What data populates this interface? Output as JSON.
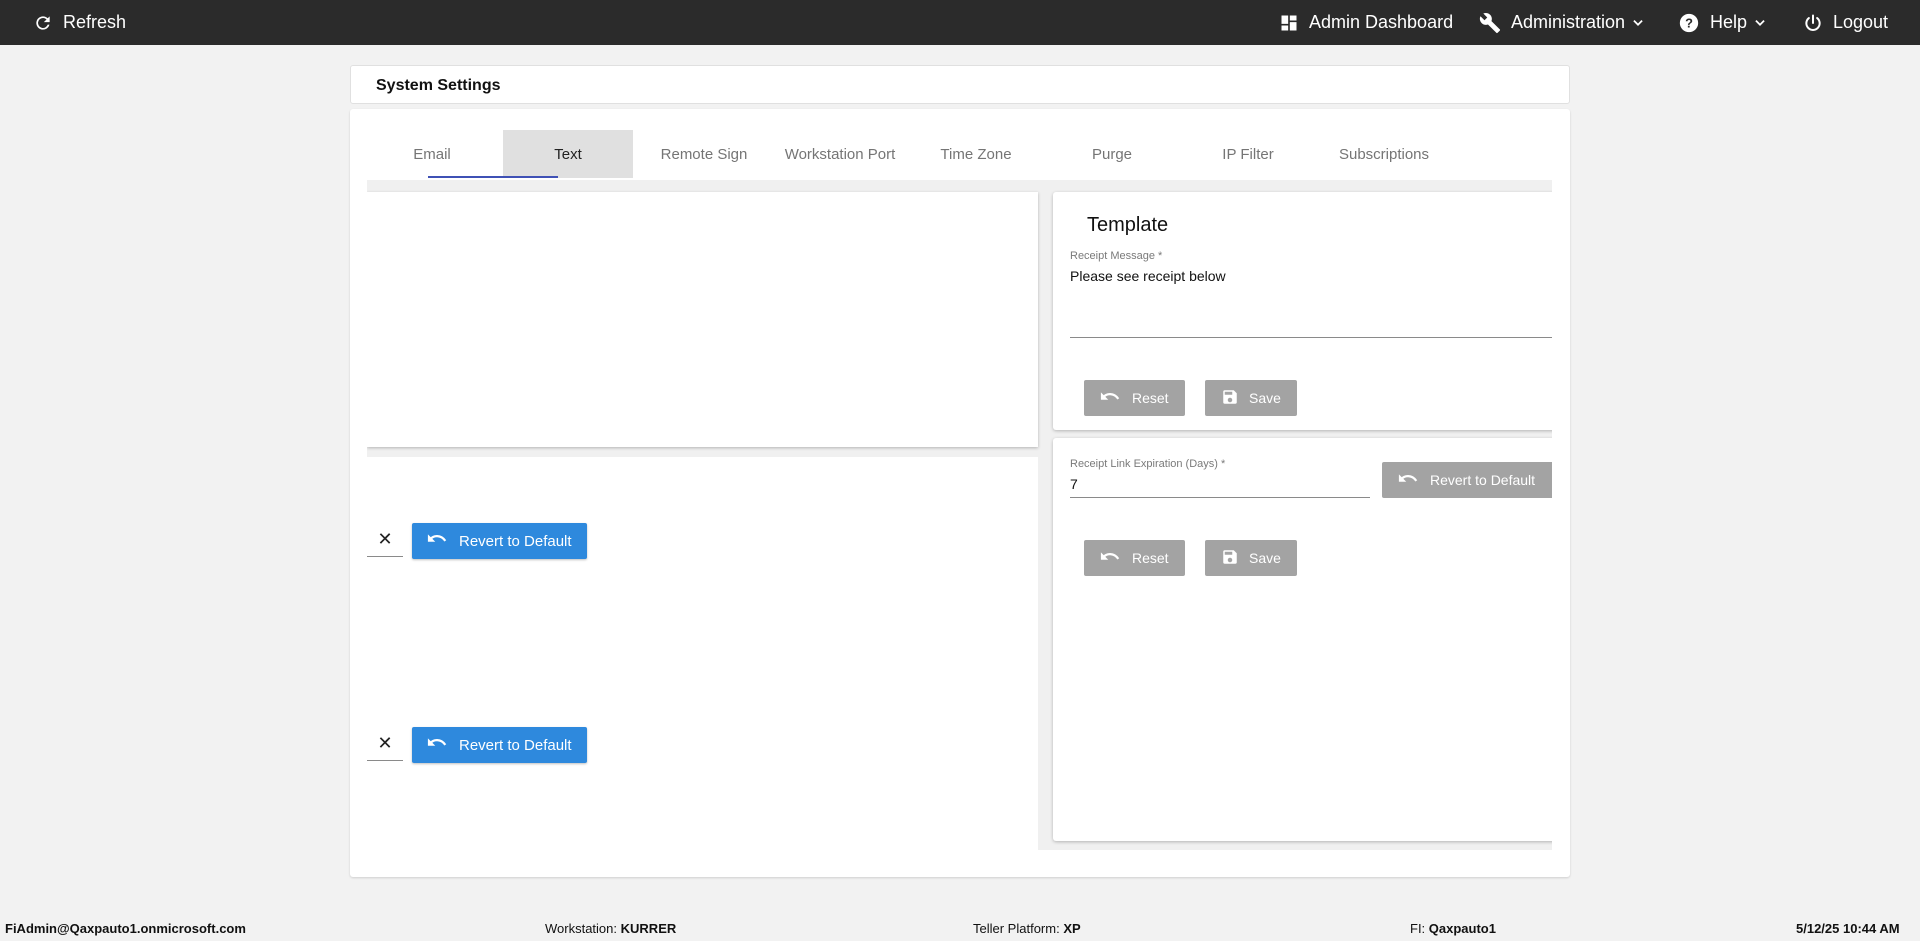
{
  "topbar": {
    "refresh_label": "Refresh",
    "admin_dashboard_label": "Admin Dashboard",
    "administration_label": "Administration",
    "help_label": "Help",
    "logout_label": "Logout"
  },
  "page": {
    "title": "System Settings"
  },
  "tabs": [
    {
      "label": "Email"
    },
    {
      "label": "Text",
      "active": true
    },
    {
      "label": "Remote Sign"
    },
    {
      "label": "Workstation Port"
    },
    {
      "label": "Time Zone"
    },
    {
      "label": "Purge"
    },
    {
      "label": "IP Filter"
    },
    {
      "label": "Subscriptions"
    }
  ],
  "left_panel": {
    "revert_1_label": "Revert to Default",
    "revert_2_label": "Revert to Default",
    "clear_symbol": "✕"
  },
  "template_panel": {
    "title": "Template",
    "receipt_message_label": "Receipt Message *",
    "receipt_message_value": "Please see receipt below",
    "reset_label": "Reset",
    "save_label": "Save"
  },
  "expiration_panel": {
    "label": "Receipt Link Expiration (Days) *",
    "value": "7",
    "revert_label": "Revert to Default",
    "reset_label": "Reset",
    "save_label": "Save"
  },
  "status_bar": {
    "user": "FiAdmin@Qaxpauto1.onmicrosoft.com",
    "workstation_label": "Workstation:",
    "workstation_value": "KURRER",
    "teller_label": "Teller Platform:",
    "teller_value": "XP",
    "fi_label": "FI:",
    "fi_value": "Qaxpauto1",
    "datetime": "5/12/25 10:44 AM"
  },
  "colors": {
    "topbar_bg": "#2b2b2b",
    "primary_button": "#2e89dd",
    "disabled_button": "#a3a3a3",
    "tab_ink": "#3f51b5"
  },
  "icons": [
    "refresh-icon",
    "dashboard-icon",
    "wrench-icon",
    "help-icon",
    "power-icon",
    "chevron-down-icon",
    "undo-icon",
    "save-icon",
    "close-icon"
  ]
}
